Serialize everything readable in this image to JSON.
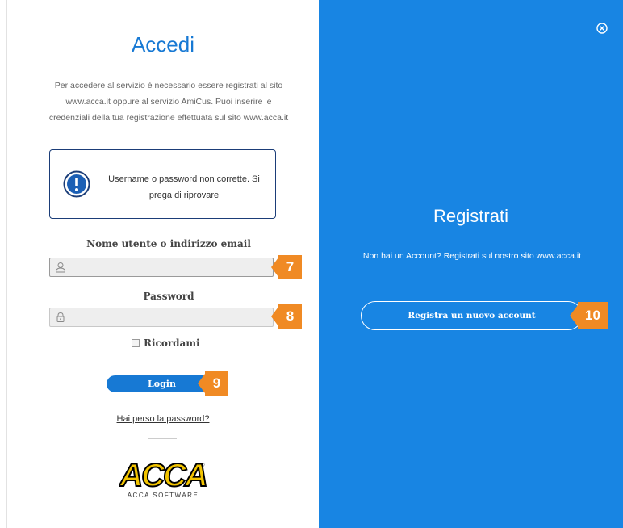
{
  "login": {
    "title": "Accedi",
    "intro": "Per accedere al servizio è necessario essere registrati al sito www.acca.it oppure al servizio AmiCus. Puoi inserire le credenziali della tua registrazione effettuata sul sito www.acca.it",
    "error_message": "Username o password non corrette. Si prega di riprovare",
    "username_label": "Nome utente o indirizzo email",
    "username_value": "",
    "password_label": "Password",
    "password_value": "",
    "remember_label": "Ricordami",
    "login_button": "Login",
    "forgot_link": "Hai perso la password?",
    "logo_text": "ACCA",
    "logo_subtext": "ACCA SOFTWARE"
  },
  "register": {
    "title": "Registrati",
    "text": "Non hai un Account? Registrati sul nostro sito www.acca.it",
    "button": "Registra un nuovo account"
  },
  "callouts": [
    "7",
    "8",
    "9",
    "10"
  ],
  "colors": {
    "accent_blue": "#1779d4",
    "panel_blue": "#1885e3",
    "callout_orange": "#f08a24",
    "error_border": "#1b3d78",
    "logo_yellow": "#f2c400"
  },
  "icons": {
    "error": "exclamation-circle-icon",
    "user": "user-icon",
    "lock": "lock-icon",
    "close": "close-circle-icon"
  }
}
